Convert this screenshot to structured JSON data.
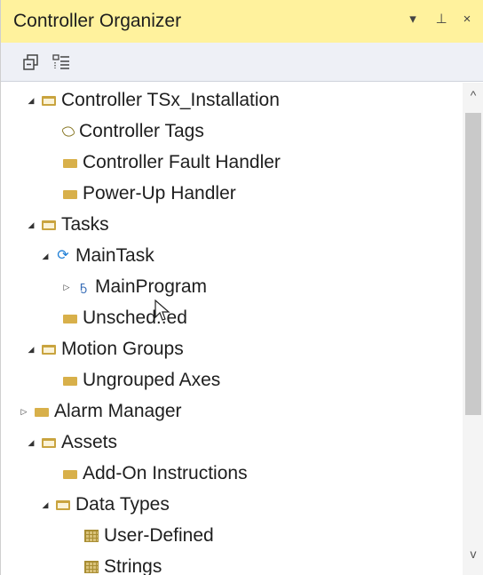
{
  "window": {
    "title": "Controller Organizer",
    "controls": {
      "dropdown": "▾",
      "pin": "⊥",
      "close": "×"
    }
  },
  "toolbar": {
    "buttons": [
      {
        "icon": "collapse-all-icon"
      },
      {
        "icon": "show-details-icon"
      }
    ]
  },
  "tree": {
    "nodes": [
      {
        "label": "Controller TSx_Installation",
        "expander": "◢",
        "icon": "folder-open-icon"
      },
      {
        "label": "Controller Tags",
        "expander": "",
        "icon": "tag-icon"
      },
      {
        "label": "Controller Fault Handler",
        "expander": "",
        "icon": "folder-icon"
      },
      {
        "label": "Power-Up Handler",
        "expander": "",
        "icon": "folder-icon"
      },
      {
        "label": "Tasks",
        "expander": "◢",
        "icon": "folder-open-icon"
      },
      {
        "label": "MainTask",
        "expander": "◢",
        "icon": "task-icon"
      },
      {
        "label": "MainProgram",
        "expander": "▷",
        "icon": "program-icon"
      },
      {
        "label": "Unsched..ed",
        "expander": "",
        "icon": "folder-icon"
      },
      {
        "label": "Motion Groups",
        "expander": "◢",
        "icon": "folder-open-icon"
      },
      {
        "label": "Ungrouped Axes",
        "expander": "",
        "icon": "folder-icon"
      },
      {
        "label": "Alarm Manager",
        "expander": "▷",
        "icon": "folder-icon"
      },
      {
        "label": "Assets",
        "expander": "◢",
        "icon": "folder-open-icon"
      },
      {
        "label": "Add-On Instructions",
        "expander": "",
        "icon": "folder-icon"
      },
      {
        "label": "Data Types",
        "expander": "◢",
        "icon": "folder-open-icon"
      },
      {
        "label": "User-Defined",
        "expander": "",
        "icon": "data-type-icon"
      },
      {
        "label": "Strings",
        "expander": "",
        "icon": "data-type-icon"
      }
    ]
  },
  "scrollbar": {
    "up": "^",
    "down": "v"
  },
  "colors": {
    "title_bar": "#fff29d",
    "toolbar": "#eef0f6",
    "folder": "#d8b04a",
    "task_icon": "#1f7fd6"
  }
}
